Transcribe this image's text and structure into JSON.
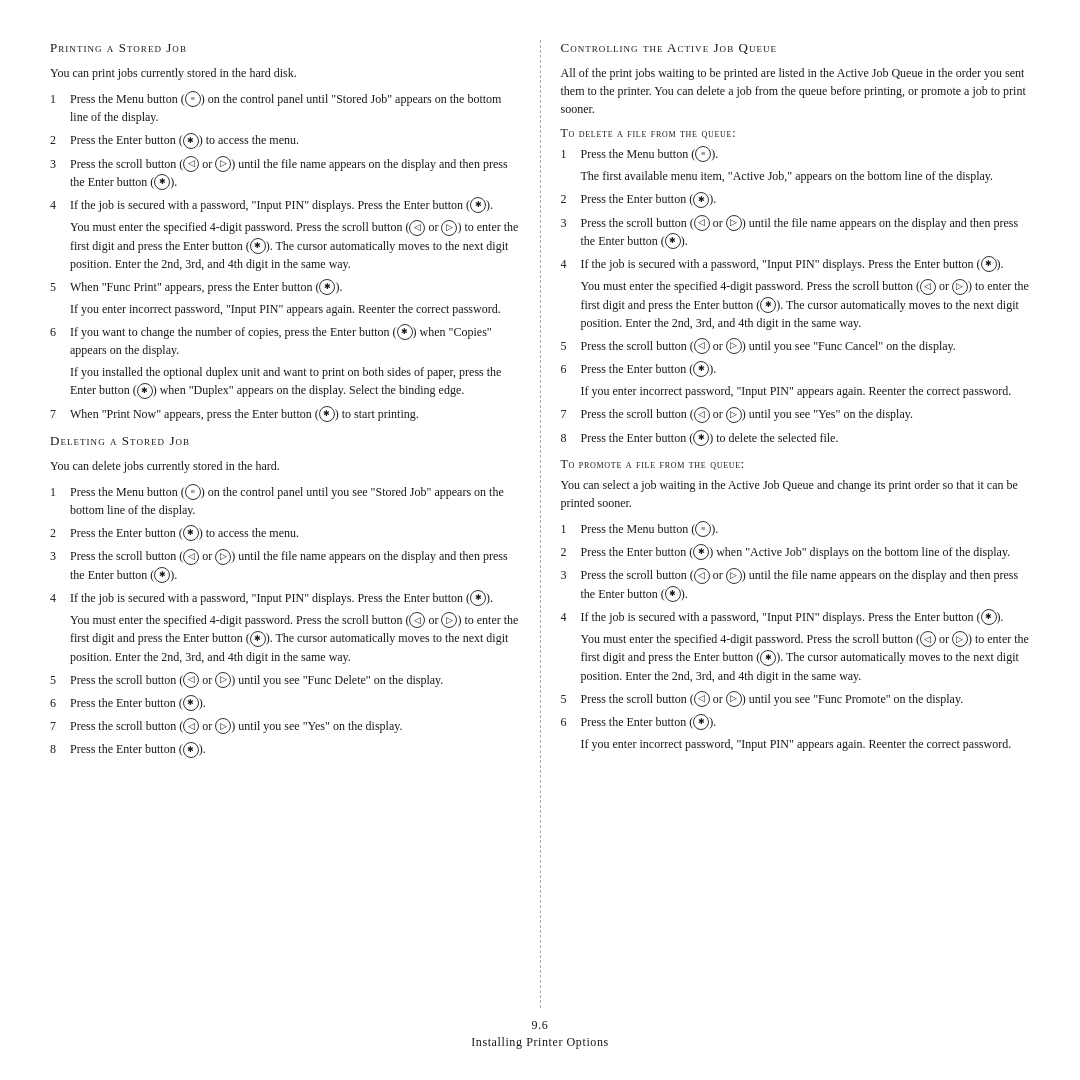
{
  "left": {
    "section1": {
      "title": "Printing a Stored Job",
      "intro": "You can print jobs currently stored in the hard disk.",
      "steps": [
        {
          "num": "1",
          "text": "Press the Menu button (",
          "icon": "menu",
          "text2": ") on the control panel until \"Stored Job\" appears on the bottom line of the display."
        },
        {
          "num": "2",
          "text": "Press the Enter button (",
          "icon": "enter",
          "text2": ") to access the menu."
        },
        {
          "num": "3",
          "text": "Press the scroll button (",
          "icon_left": "scroll-left",
          "text_or": " or ",
          "icon_right": "scroll-right",
          "text3": ") until the file name appears on the display and then press the Enter button (",
          "icon3": "enter",
          "text4": ")."
        },
        {
          "num": "4",
          "text_main": "If the job is secured with a password, \"Input PIN\" displays. Press the Enter button (",
          "icon_main": "enter",
          "text_main2": ").",
          "sub": "You must enter the specified 4-digit password. Press the scroll button (◁ or ▷) to enter the first digit and press the Enter button (✻). The cursor automatically moves to the next digit position. Enter the 2nd, 3rd, and 4th digit in the same way."
        },
        {
          "num": "5",
          "text": "When \"Func Print\" appears, press the Enter button (",
          "icon": "enter",
          "text2": ").",
          "sub": "If you enter incorrect password, \"Input PIN\" appears again. Reenter the correct password."
        },
        {
          "num": "6",
          "text_main": "If you want to change the number of copies, press the Enter button (",
          "icon_main": "enter",
          "text_main2": ") when \"Copies\" appears on the display.",
          "sub": "If you installed the optional duplex unit and want to print on both sides of paper, press the Enter button (✻) when \"Duplex\" appears on the display. Select the binding edge."
        },
        {
          "num": "7",
          "text": "When \"Print Now\" appears, press the Enter button (",
          "icon": "enter",
          "text2": ") to start printing."
        }
      ]
    },
    "section2": {
      "title": "Deleting a Stored Job",
      "intro": "You can delete jobs currently stored in the hard.",
      "steps": [
        {
          "num": "1",
          "text": "Press the Menu button (",
          "icon": "menu",
          "text2": ") on the control panel until you see \"Stored Job\" appears on the bottom line of the display."
        },
        {
          "num": "2",
          "text": "Press the Enter button (",
          "icon": "enter",
          "text2": ") to access the menu."
        },
        {
          "num": "3",
          "text": "Press the scroll button (",
          "icon_left": "scroll-left",
          "text_or": " or ",
          "icon_right": "scroll-right",
          "text3": ") until the file name appears on the display and then press the Enter button (",
          "icon3": "enter",
          "text4": ")."
        },
        {
          "num": "4",
          "text_main": "If the job is secured with a password, \"Input PIN\" displays. Press the Enter button (",
          "icon_main": "enter",
          "text_main2": ").",
          "sub": "You must enter the specified 4-digit password. Press the scroll button (◁ or ▷) to enter the first digit and press the Enter button (✻). The cursor automatically moves to the next digit position. Enter the 2nd, 3rd, and 4th digit in the same way."
        },
        {
          "num": "5",
          "text": "Press the scroll button (",
          "icon_left": "scroll-left",
          "text_or": " or ",
          "icon_right": "scroll-right",
          "text3": ") until you see \"Func Delete\" on the display."
        },
        {
          "num": "6",
          "text": "Press the Enter button (",
          "icon": "enter",
          "text2": ")."
        },
        {
          "num": "7",
          "text": "Press the scroll button (",
          "icon_left": "scroll-left",
          "text_or": " or ",
          "icon_right": "scroll-right",
          "text3": ") until you see \"Yes\" on the display."
        },
        {
          "num": "8",
          "text": "Press the Enter button (",
          "icon": "enter",
          "text2": ")."
        }
      ]
    }
  },
  "right": {
    "section1": {
      "title": "Controlling the Active Job Queue",
      "intro": "All of the print jobs waiting to be printed are listed in the Active Job Queue in the order you sent them to the printer. You can delete a job from the queue before printing, or promote a job to print sooner.",
      "subsection1": {
        "title": "To delete a file from the queue:",
        "steps": [
          {
            "num": "1",
            "text_main": "Press the Menu button (",
            "icon_main": "menu",
            "text_main2": ").",
            "sub": "The first available menu item, \"Active Job,\" appears on the bottom line of the display."
          },
          {
            "num": "2",
            "text": "Press the Enter button (",
            "icon": "enter",
            "text2": ")."
          },
          {
            "num": "3",
            "text": "Press the scroll button (",
            "icon_left": "scroll-left",
            "text_or": " or ",
            "icon_right": "scroll-right",
            "text3": ") until the file name appears on the display and then press the Enter button (",
            "icon3": "enter",
            "text4": ")."
          },
          {
            "num": "4",
            "text_main": "If the job is secured with a password, \"Input PIN\" displays. Press the Enter button (",
            "icon_main": "enter",
            "text_main2": ").",
            "sub": "You must enter the specified 4-digit password. Press the scroll button (◁ or ▷) to enter the first digit and press the Enter button (✻). The cursor automatically moves to the next digit position. Enter the 2nd, 3rd, and 4th digit in the same way."
          },
          {
            "num": "5",
            "text": "Press the scroll button (",
            "icon_left": "scroll-left",
            "text_or": " or ",
            "icon_right": "scroll-right",
            "text3": ") until you see \"Func Cancel\" on the display."
          },
          {
            "num": "6",
            "text": "Press the Enter button (",
            "icon": "enter",
            "text2": ").",
            "sub": "If you enter incorrect password, \"Input PIN\" appears again. Reenter the correct password."
          },
          {
            "num": "7",
            "text": "Press the scroll button (",
            "icon_left": "scroll-left",
            "text_or": " or ",
            "icon_right": "scroll-right",
            "text3": ") until you see \"Yes\" on the display."
          },
          {
            "num": "8",
            "text": "Press the Enter button (",
            "icon": "enter",
            "text2": ") to delete the selected file."
          }
        ]
      },
      "subsection2": {
        "title": "To promote a file from the queue:",
        "intro": "You can select a job waiting in the Active Job Queue and change its print order so that it can be printed sooner.",
        "steps": [
          {
            "num": "1",
            "text": "Press the Menu button (",
            "icon": "menu",
            "text2": ")."
          },
          {
            "num": "2",
            "text": "Press the Enter button (",
            "icon": "enter",
            "text2": ") when \"Active Job\" displays on the bottom line of the display."
          },
          {
            "num": "3",
            "text": "Press the scroll button (",
            "icon_left": "scroll-left",
            "text_or": " or ",
            "icon_right": "scroll-right",
            "text3": ") until the file name appears on the display and then press the Enter button (",
            "icon3": "enter",
            "text4": ")."
          },
          {
            "num": "4",
            "text_main": "If the job is secured with a password, \"Input PIN\" displays. Press the Enter button (",
            "icon_main": "enter",
            "text_main2": ").",
            "sub": "You must enter the specified 4-digit password. Press the scroll button (◁ or ▷) to enter the first digit and press the Enter button (✻). The cursor automatically moves to the next digit position. Enter the 2nd, 3rd, and 4th digit in the same way."
          },
          {
            "num": "5",
            "text": "Press the scroll button (",
            "icon_left": "scroll-left",
            "text_or": " or ",
            "icon_right": "scroll-right",
            "text3": ") until you see \"Func Promote\" on the display."
          },
          {
            "num": "6",
            "text": "Press the Enter button (",
            "icon": "enter",
            "text2": ").",
            "sub": "If you enter incorrect password, \"Input PIN\" appears again. Reenter the correct password."
          }
        ]
      }
    }
  },
  "footer": {
    "page_num": "9.6",
    "label": "Installing Printer Options"
  },
  "icons": {
    "menu_symbol": "≡",
    "enter_symbol": "✱",
    "scroll_left_symbol": "◁",
    "scroll_right_symbol": "▷"
  }
}
